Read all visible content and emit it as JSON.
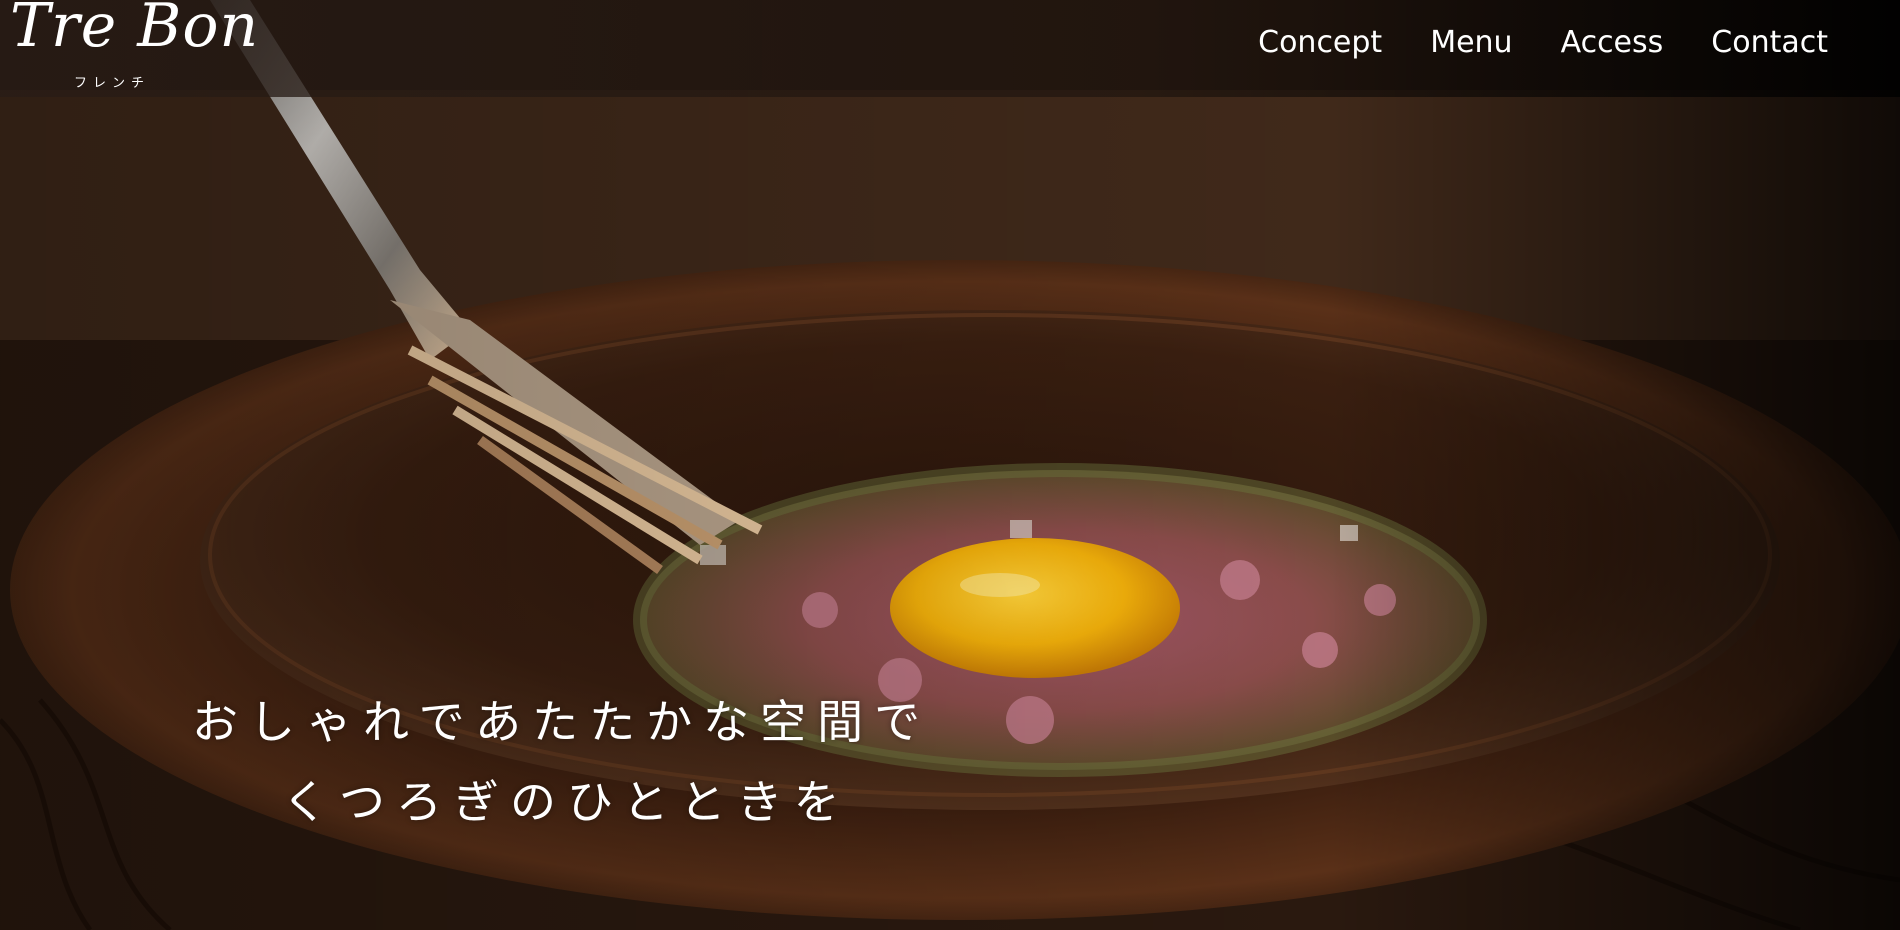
{
  "brand": {
    "logo_text": "Tre Bon",
    "logo_sub": "フレンチ"
  },
  "nav": {
    "items": [
      {
        "label": "Concept"
      },
      {
        "label": "Menu"
      },
      {
        "label": "Access"
      },
      {
        "label": "Contact"
      }
    ]
  },
  "hero": {
    "image": "dish-photo",
    "catch_line_1": "おしゃれであたたかな空間で",
    "catch_line_2": "くつろぎのひとときを"
  },
  "colors": {
    "header_bg": "#2a1c15",
    "text": "#ffffff",
    "yolk": "#f2b00a"
  }
}
